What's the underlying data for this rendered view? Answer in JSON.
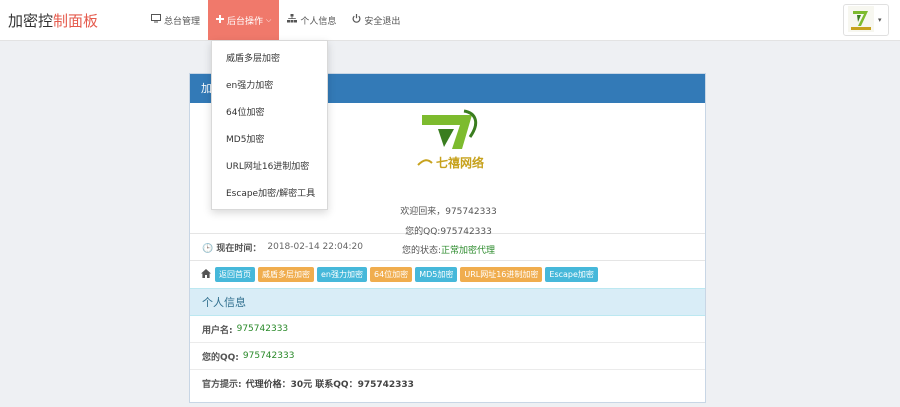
{
  "brand": {
    "part1": "加密控",
    "part2": "制面板",
    "accent_color": "#e55b4d"
  },
  "nav": {
    "items": [
      {
        "label": "总台管理",
        "icon": "monitor-icon"
      },
      {
        "label": "后台操作",
        "icon": "plus-icon",
        "active": true
      },
      {
        "label": "个人信息",
        "icon": "sitemap-icon"
      },
      {
        "label": "安全退出",
        "icon": "power-icon"
      }
    ],
    "active_color": "#f0796b"
  },
  "dropdown": {
    "items": [
      "威盾多层加密",
      "en强力加密",
      "64位加密",
      "MD5加密",
      "URL网址16进制加密",
      "Escape加密/解密工具"
    ]
  },
  "panel": {
    "title_visible": "加",
    "head_color": "#337ab7",
    "logo_text": "七禧网络",
    "welcome_line": "欢迎回来，975742333",
    "qq_line": "您的QQ:975742333",
    "status_label": "您的状态:",
    "status_value": "正常加密代理",
    "time_label": "现在时间：",
    "time_value": "2018-02-14 22:04:20",
    "tags": [
      {
        "label": "返回首页",
        "color": "cyan"
      },
      {
        "label": "威盾多层加密",
        "color": "orange"
      },
      {
        "label": "en强力加密",
        "color": "cyan"
      },
      {
        "label": "64位加密",
        "color": "orange"
      },
      {
        "label": "MD5加密",
        "color": "cyan"
      },
      {
        "label": "URL网址16进制加密",
        "color": "orange"
      },
      {
        "label": "Escape加密",
        "color": "cyan"
      }
    ]
  },
  "info": {
    "title": "个人信息",
    "username_label": "用户名:",
    "username_value": "975742333",
    "qq_label": "您的QQ:",
    "qq_value": "975742333",
    "notice_label": "官方提示:",
    "notice_value": "代理价格：30元 联系QQ：975742333"
  }
}
